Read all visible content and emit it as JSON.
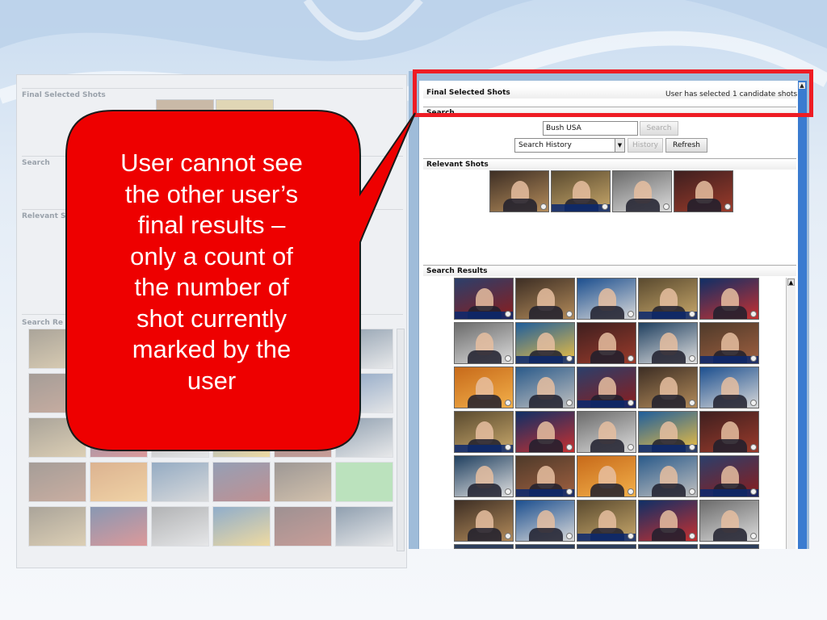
{
  "left_window": {
    "final_selected_shots": "Final Selected Shots",
    "search": "Search",
    "relevant_shots": "Relevant S",
    "search_results": "Search Re"
  },
  "right_window": {
    "final_selected_shots": "Final Selected Shots",
    "status": "User has selected 1 candidate shots",
    "search_label": "Search",
    "search_input_value": "Bush USA",
    "search_button": "Search",
    "history_select_value": "Search History",
    "history_button": "History",
    "refresh_button": "Refresh",
    "relevant_shots_label": "Relevant Shots",
    "search_results_label": "Search Results"
  },
  "callout": {
    "line1": "User cannot see",
    "line2": "the other user’s",
    "line3": "final results –",
    "line4": "only a count of",
    "line5": "the number of",
    "line6": "shot currently",
    "line7": "marked by the",
    "line8": "user"
  },
  "colors": {
    "callout_fill": "#ee0000",
    "highlight_border": "#ee1c24",
    "panel_blue": "#9fbcd9"
  }
}
